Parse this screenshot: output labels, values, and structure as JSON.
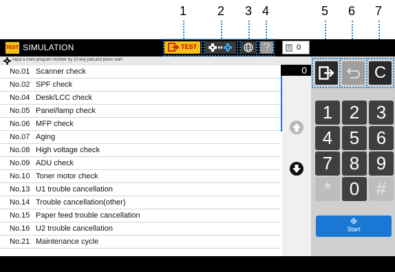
{
  "callouts": [
    "1",
    "2",
    "3",
    "4",
    "5",
    "6",
    "7"
  ],
  "app": {
    "logo_text": "TEST",
    "title": "SIMULATION"
  },
  "header": {
    "test_label": "TEST",
    "counter_value": "0"
  },
  "instruction": "Input a main program number by 10-key pad,and press start",
  "display_value": "0",
  "list": [
    {
      "no": "No.01",
      "name": "Scanner check"
    },
    {
      "no": "No.02",
      "name": "SPF check"
    },
    {
      "no": "No.04",
      "name": "Desk/LCC check"
    },
    {
      "no": "No.05",
      "name": "Panel/lamp check"
    },
    {
      "no": "No.06",
      "name": "MFP check"
    },
    {
      "no": "No.07",
      "name": "Aging"
    },
    {
      "no": "No.08",
      "name": "High voltage check"
    },
    {
      "no": "No.09",
      "name": "ADU check"
    },
    {
      "no": "No.10",
      "name": "Toner motor check"
    },
    {
      "no": "No.13",
      "name": "U1 trouble cancellation"
    },
    {
      "no": "No.14",
      "name": "Trouble cancellation(other)"
    },
    {
      "no": "No.15",
      "name": "Paper feed trouble cancellation"
    },
    {
      "no": "No.16",
      "name": "U2 trouble cancellation"
    },
    {
      "no": "No.21",
      "name": "Maintenance cycle"
    }
  ],
  "keypad": {
    "k1": "1",
    "k2": "2",
    "k3": "3",
    "k4": "4",
    "k5": "5",
    "k6": "6",
    "k7": "7",
    "k8": "8",
    "k9": "9",
    "kstar": "*",
    "k0": "0",
    "khash": "#"
  },
  "clear_label": "C",
  "start_label": "Start",
  "colors": {
    "accent": "#1a78d4",
    "callout": "#2a8ad1",
    "test_yellow": "#f3c018"
  },
  "icons": [
    "logo-icon",
    "settings-gear-icon",
    "test-mode-icon",
    "switch-mode-icon",
    "globe-icon",
    "help-icon",
    "counter-icon",
    "exit-icon",
    "back-icon",
    "scroll-up-icon",
    "scroll-down-icon",
    "start-icon"
  ]
}
